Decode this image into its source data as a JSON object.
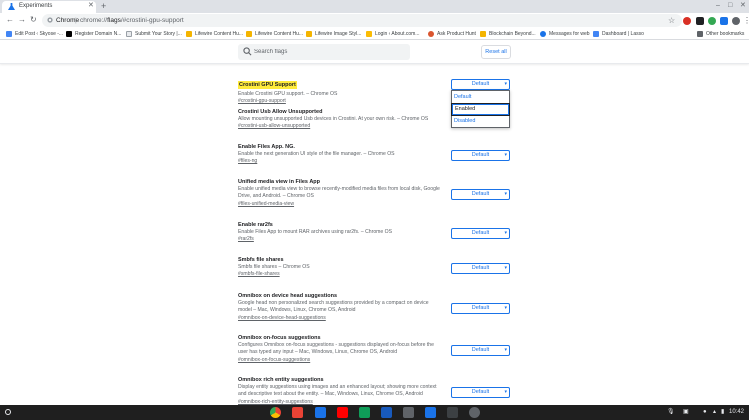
{
  "browser": {
    "tab_title": "Experiments",
    "omnibox_prefix": "Chrome",
    "omnibox_url_host": "chrome://",
    "omnibox_url_path_bold": "flags",
    "omnibox_url_rest": "/#crostini-gpu-support"
  },
  "bookmarks": [
    {
      "label": "Edit Post ‹ Skyose -...",
      "color": "#4285f4"
    },
    {
      "label": "Register Domain N...",
      "color": "#000000"
    },
    {
      "label": "Submit Your Story |...",
      "color": "#e8eaed"
    },
    {
      "label": "Lifewire Content Hu...",
      "color": "#f4b400"
    },
    {
      "label": "Lifewire Content Hu...",
      "color": "#f4b400"
    },
    {
      "label": "Lifewire Image Styl...",
      "color": "#f4b400"
    },
    {
      "label": "Login ‹ About.com...",
      "color": "#fbbc04"
    },
    {
      "label": "Ask Product Hunt",
      "color": "#da552f"
    },
    {
      "label": "Blockchain Beyond...",
      "color": "#f4b400"
    },
    {
      "label": "Messages for web",
      "color": "#1a73e8"
    },
    {
      "label": "Dashboard | Lasso",
      "color": "#4285f4"
    }
  ],
  "other_bookmarks": "Other bookmarks",
  "search": {
    "placeholder": "Search flags"
  },
  "reset_label": "Reset all",
  "dropdown_options": [
    "Default",
    "Enabled",
    "Disabled"
  ],
  "flags": [
    {
      "name": "Crostini GPU Support",
      "desc": "Enable Crostini GPU support. – Chrome OS",
      "link": "#crostini-gpu-support",
      "value": "Default",
      "highlighted": true
    },
    {
      "name": "Crostini Usb Allow Unsupported",
      "desc": "Allow mounting unsupported Usb devices in Crostini. At your own risk. – Chrome OS",
      "link": "#crostini-usb-allow-unsupported",
      "value": ""
    },
    {
      "name": "Enable Files App. NG.",
      "desc": "Enable the next generation UI style of the file manager. – Chrome OS",
      "link": "#files-ng",
      "value": "Default"
    },
    {
      "name": "Unified media view in Files App",
      "desc": "Enable unified media view to browse recently-modified media files from local disk, Google Drive, and Android. – Chrome OS",
      "link": "#files-unified-media-view",
      "value": "Default"
    },
    {
      "name": "Enable rar2fs",
      "desc": "Enable Files App to mount RAR archives using rar2fs. – Chrome OS",
      "link": "#rar2fs",
      "value": "Default"
    },
    {
      "name": "Smbfs file shares",
      "desc": "Smbfs file shares – Chrome OS",
      "link": "#smbfs-file-shares",
      "value": "Default"
    },
    {
      "name": "Omnibox on device head suggestions",
      "desc": "Google head non personalized search suggestions provided by a compact on device model – Mac, Windows, Linux, Chrome OS, Android",
      "link": "#omnibox-on-device-head-suggestions",
      "value": "Default"
    },
    {
      "name": "Omnibox on-focus suggestions",
      "desc": "Configures Omnibox on-focus suggestions - suggestions displayed on-focus before the user has typed any input – Mac, Windows, Linux, Chrome OS, Android",
      "link": "#omnibox-on-focus-suggestions",
      "value": "Default"
    },
    {
      "name": "Omnibox rich entity suggestions",
      "desc": "Display entity suggestions using images and an enhanced layout; showing more context and descriptive text about the entity. – Mac, Windows, Linux, Chrome OS, Android",
      "link": "#omnibox-rich-entity-suggestions",
      "value": "Default"
    }
  ],
  "shelf": {
    "time": "10:42"
  },
  "colors": {
    "accent": "#1a73e8",
    "highlight": "#ffeb3b",
    "shelf": "#1f1f1f"
  }
}
